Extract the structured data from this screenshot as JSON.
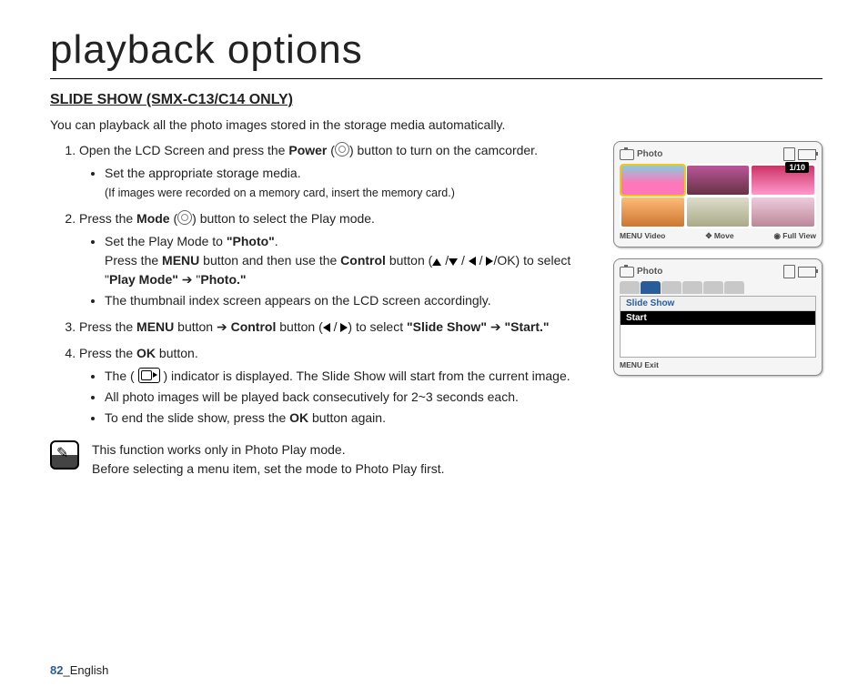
{
  "title": "playback options",
  "section": "SLIDE SHOW (SMX-C13/C14 ONLY)",
  "intro": "You can playback all the photo images stored in the storage media automatically.",
  "steps": {
    "s1_a": "Open the LCD Screen and press the ",
    "s1_b": "Power",
    "s1_c": " button to turn on the camcorder.",
    "s1_bul": "Set the appropriate storage media.",
    "s1_note": "(If images were recorded on a memory card, insert the memory card.)",
    "s2_a": "Press the ",
    "s2_b": "Mode",
    "s2_c": " button to select the Play mode.",
    "s2_bul1_a": "Set the Play Mode to ",
    "s2_bul1_b": "\"Photo\"",
    "s2_bul1_c": ".",
    "s2_bul1_d": "Press the ",
    "s2_bul1_e": "MENU",
    "s2_bul1_f": " button and then use the ",
    "s2_bul1_g": "Control",
    "s2_bul1_h": " button (",
    "s2_bul1_i": "/OK) to select \"",
    "s2_bul1_j": "Play Mode\"",
    "s2_bul1_k": " ➔ \"",
    "s2_bul1_l": "Photo.\"",
    "s2_bul2": "The thumbnail index screen appears on the LCD screen accordingly.",
    "s3_a": "Press the ",
    "s3_b": "MENU",
    "s3_c": " button ➔ ",
    "s3_d": "Control",
    "s3_e": " button (",
    "s3_f": ") to select ",
    "s3_g": "\"Slide Show\"",
    "s3_h": " ➔ ",
    "s3_i": "\"Start.\"",
    "s4_a": "Press the ",
    "s4_b": "OK",
    "s4_c": " button.",
    "s4_bul1_a": "The ( ",
    "s4_bul1_b": " ) indicator is displayed. The Slide Show will start from the current image.",
    "s4_bul2": "All photo images will be played back consecutively for 2~3 seconds each.",
    "s4_bul3_a": "To end the slide show, press the ",
    "s4_bul3_b": "OK",
    "s4_bul3_c": " button again."
  },
  "note1": "This function works only in Photo Play mode.",
  "note2": "Before selecting a menu item, set the mode to Photo Play first.",
  "footer_num": "82",
  "footer_lang": "_English",
  "screen1": {
    "mode": "Photo",
    "counter": "1/10",
    "bot_left": "MENU Video",
    "bot_mid": "✥ Move",
    "bot_right": "◉ Full View"
  },
  "screen2": {
    "mode": "Photo",
    "menu_head": "Slide Show",
    "menu_item": "Start",
    "bot": "MENU Exit"
  },
  "thumbs": [
    {
      "c": "linear-gradient(#8cd,#f7b 60%)"
    },
    {
      "c": "linear-gradient(#b59,#634)"
    },
    {
      "c": "linear-gradient(#c36,#f9c)"
    },
    {
      "c": "linear-gradient(#fb7,#c73)"
    },
    {
      "c": "linear-gradient(#ddc,#aa8)"
    },
    {
      "c": "linear-gradient(#ecd,#b89)"
    }
  ]
}
